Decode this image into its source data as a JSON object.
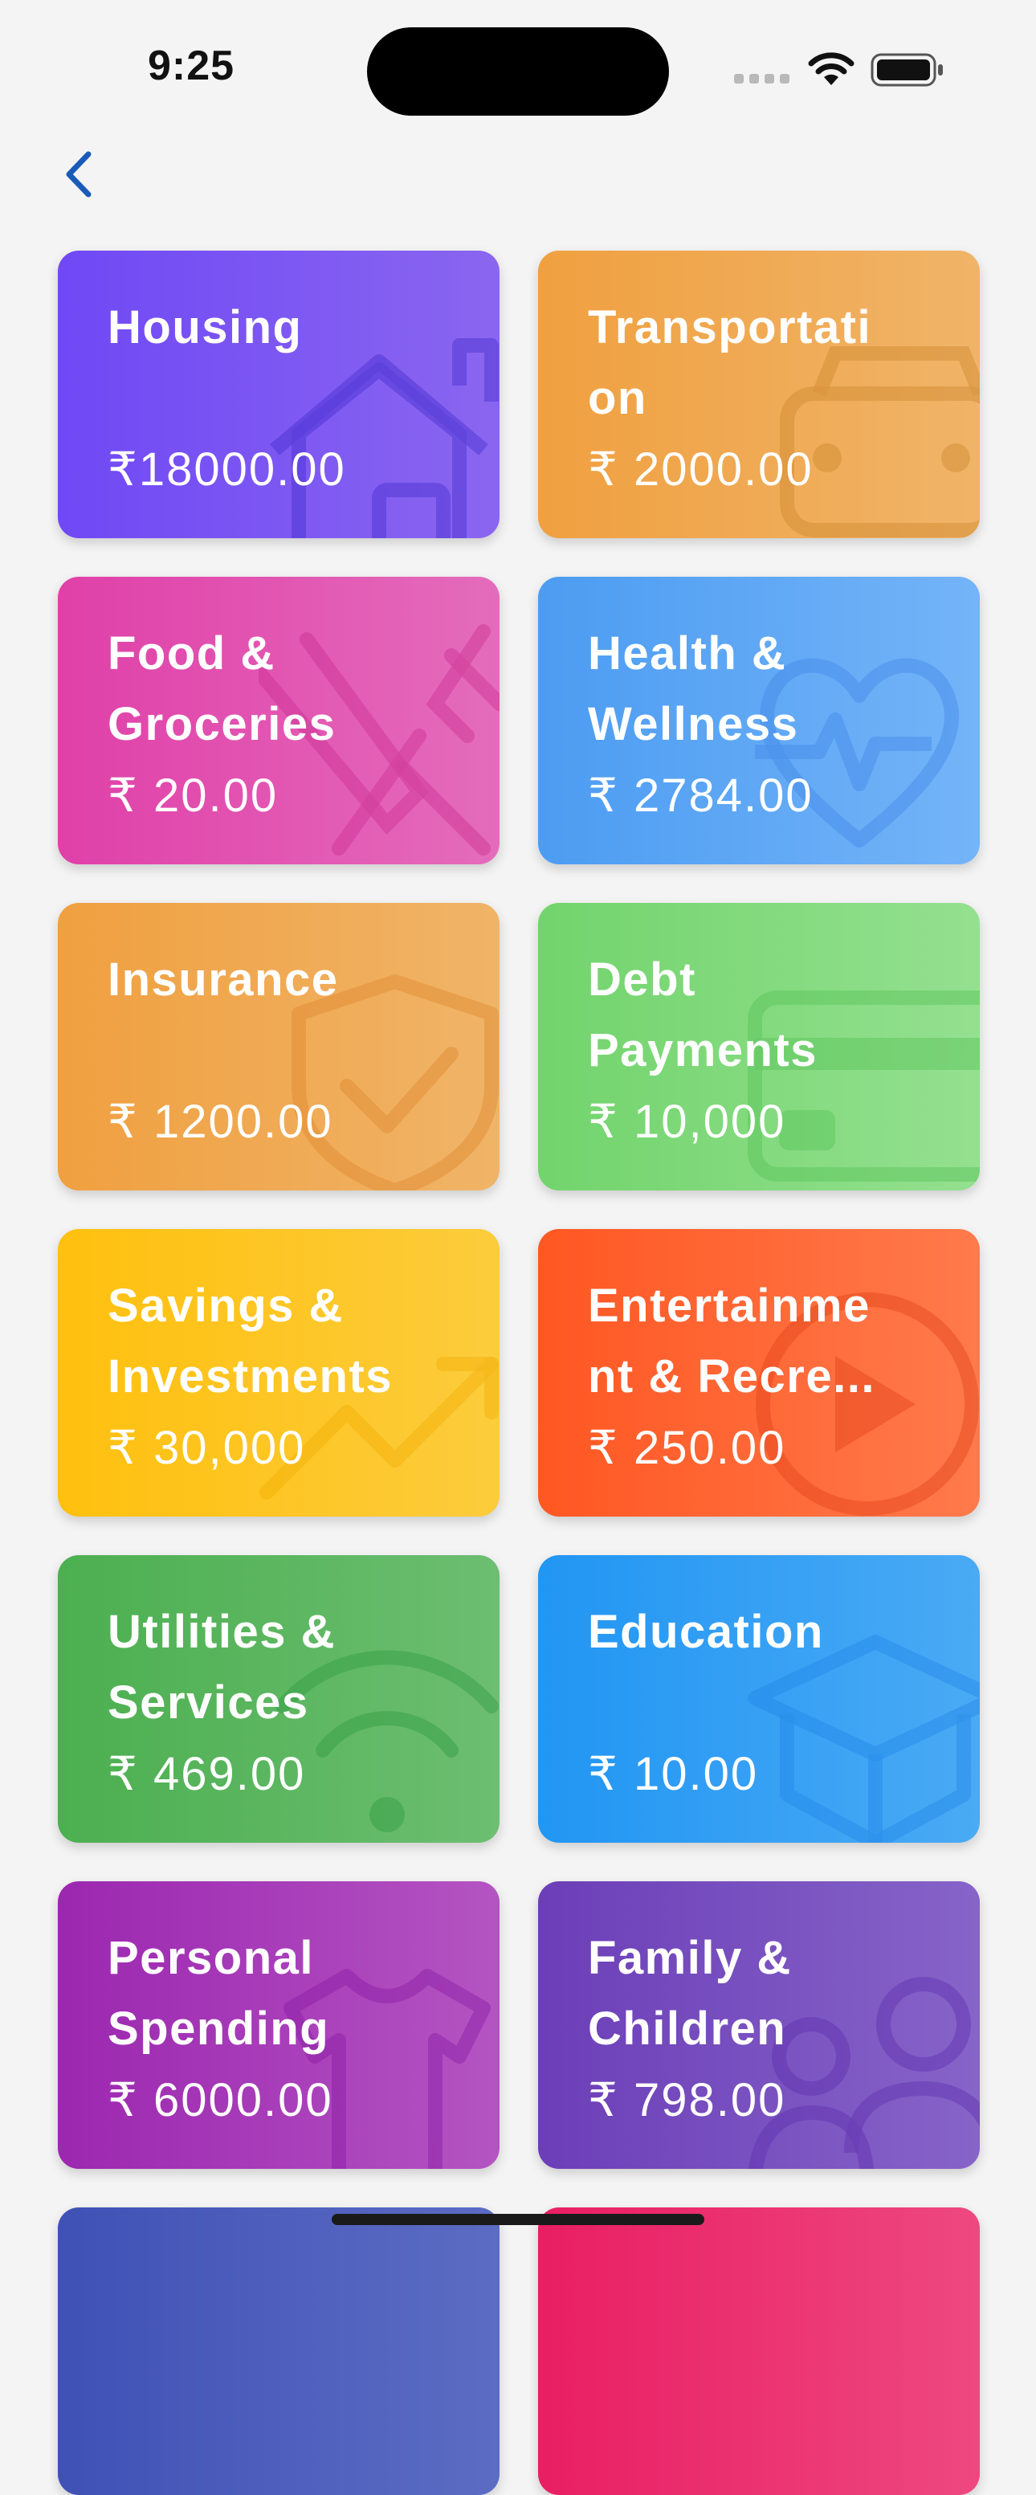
{
  "status_bar": {
    "time": "9:25"
  },
  "nav": {
    "back_icon": "chevron-left-icon",
    "accent": "#1a5bb8"
  },
  "categories": [
    {
      "id": "housing",
      "title": "Housing",
      "amount": "₹18000.00",
      "icon": "house-icon",
      "color_start": "#7048f5",
      "color_end": "#8a66f0"
    },
    {
      "id": "transportation",
      "title": "Transportati\non",
      "amount": "₹ 2000.00",
      "icon": "car-icon",
      "color_start": "#f0a040",
      "color_end": "#f0b468"
    },
    {
      "id": "food-groceries",
      "title": "Food &\nGroceries",
      "amount": "₹ 20.00",
      "icon": "utensils-icon",
      "color_start": "#e040a8",
      "color_end": "#e46cbc"
    },
    {
      "id": "health-wellness",
      "title": "Health &\nWellness",
      "amount": "₹ 2784.00",
      "icon": "heartbeat-icon",
      "color_start": "#4c9cf2",
      "color_end": "#74b4f8"
    },
    {
      "id": "insurance",
      "title": "Insurance",
      "amount": "₹ 1200.00",
      "icon": "shield-check-icon",
      "color_start": "#f0a040",
      "color_end": "#f0b468"
    },
    {
      "id": "debt-payments",
      "title": "Debt\nPayments",
      "amount": "₹ 10,000",
      "icon": "credit-card-icon",
      "color_start": "#72d46c",
      "color_end": "#94e090"
    },
    {
      "id": "savings-investments",
      "title": "Savings &\nInvestments",
      "amount": "₹ 30,000",
      "icon": "trending-up-icon",
      "color_start": "#ffc00e",
      "color_end": "#fccc3c"
    },
    {
      "id": "entertainment",
      "title": "Entertainme\nnt & Recre...",
      "amount": "₹ 250.00",
      "icon": "play-icon",
      "color_start": "#ff5722",
      "color_end": "#ff7a4c"
    },
    {
      "id": "utilities-services",
      "title": "Utilities &\nServices",
      "amount": "₹ 469.00",
      "icon": "wifi-icon",
      "color_start": "#4caf50",
      "color_end": "#6cbe70"
    },
    {
      "id": "education",
      "title": "Education",
      "amount": "₹ 10.00",
      "icon": "graduation-cap-icon",
      "color_start": "#2196f3",
      "color_end": "#4aaaf4"
    },
    {
      "id": "personal-spending",
      "title": "Personal\nSpending",
      "amount": "₹ 6000.00",
      "icon": "shirt-icon",
      "color_start": "#9c27b0",
      "color_end": "#b454c2"
    },
    {
      "id": "family-children",
      "title": "Family &\nChildren",
      "amount": "₹ 798.00",
      "icon": "people-icon",
      "color_start": "#6c3eb8",
      "color_end": "#8664c8"
    },
    {
      "id": "partial-left",
      "title": "",
      "amount": "",
      "icon": "",
      "color_start": "#3f51b5",
      "color_end": "#5c6cc4"
    },
    {
      "id": "partial-right",
      "title": "",
      "amount": "",
      "icon": "",
      "color_start": "#e91e63",
      "color_end": "#ee4880"
    }
  ]
}
